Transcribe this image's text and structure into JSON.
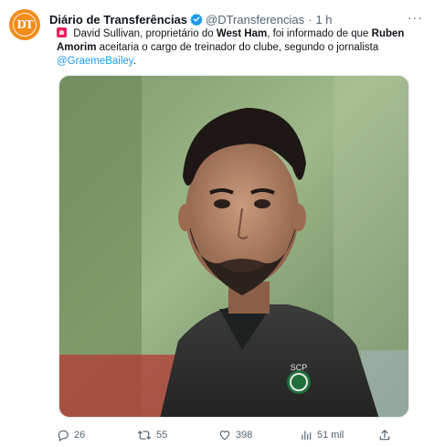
{
  "tweet": {
    "display_name": "Diário de Transferências",
    "handle": "@DTransferencias",
    "separator": "·",
    "time": "1 h",
    "more": "···",
    "avatar_text": "DT",
    "text": {
      "part1": " David Sullivan, proprietário do ",
      "bold1": "West Ham",
      "part2": ", foi informado de que ",
      "bold2": "Ruben Amorim",
      "part3": " aceitaria o cargo de treinador do clube, segundo o jornalista ",
      "mention": "@GraemeBailey",
      "part4": "."
    },
    "media_shirt_text": "SCP"
  },
  "actions": {
    "replies": "26",
    "retweets": "55",
    "likes": "398",
    "views": "51 mil"
  },
  "colors": {
    "accent": "#1d9bf0",
    "avatar": "#f28c1b",
    "text": "#0f1419",
    "muted": "#536471"
  },
  "icons": {
    "verified": "verified-badge-icon",
    "reply": "reply-icon",
    "retweet": "retweet-icon",
    "like": "heart-icon",
    "views": "bar-chart-icon",
    "share": "share-icon",
    "more": "more-dots-icon",
    "siren": "siren-icon"
  }
}
